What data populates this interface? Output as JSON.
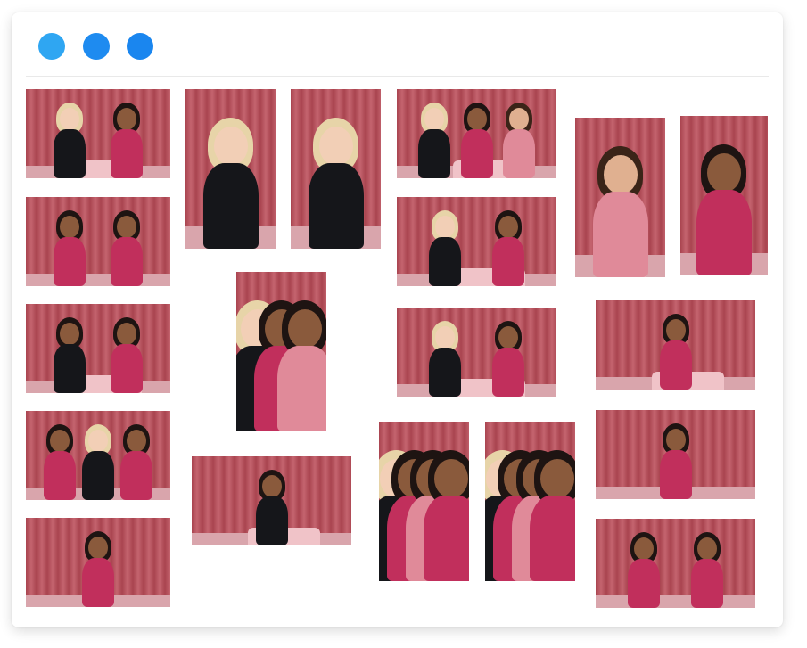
{
  "window": {
    "controls": [
      {
        "name": "window-control-1",
        "color": "#2fa6f2"
      },
      {
        "name": "window-control-2",
        "color": "#1e8bf0"
      },
      {
        "name": "window-control-3",
        "color": "#1a86ef"
      }
    ]
  },
  "palette": {
    "curtain_dark": "#a9444f",
    "curtain_light": "#c4646f",
    "skin_light": "#f2cfb6",
    "skin_tan": "#e0b090",
    "skin_brown": "#8a5a3c",
    "skin_dark": "#6a3f2a",
    "hair_blonde": "#e7d4a8",
    "hair_dark": "#1e1412",
    "hair_brown": "#3a2418",
    "dress_black": "#15161a",
    "dress_magenta": "#c12f5c",
    "dress_pink": "#e08a99",
    "plinth": "#f0c3c8"
  },
  "gallery": {
    "photos": [
      {
        "name": "photo-duo-seated-1",
        "figures": [
          [
            "blonde",
            "black"
          ],
          [
            "dark",
            "magenta"
          ]
        ]
      },
      {
        "name": "photo-duo-standing-1",
        "figures": [
          [
            "dark",
            "magenta"
          ],
          [
            "dark",
            "magenta"
          ]
        ]
      },
      {
        "name": "photo-duo-seated-2",
        "figures": [
          [
            "dark",
            "black"
          ],
          [
            "dark",
            "magenta"
          ]
        ]
      },
      {
        "name": "photo-trio-1",
        "figures": [
          [
            "dark",
            "magenta"
          ],
          [
            "blonde",
            "black"
          ],
          [
            "dark",
            "magenta"
          ]
        ]
      },
      {
        "name": "photo-solo-portrait-1",
        "figures": [
          [
            "dark",
            "magenta"
          ]
        ]
      },
      {
        "name": "photo-solo-blonde-1",
        "figures": [
          [
            "blonde",
            "black"
          ]
        ]
      },
      {
        "name": "photo-solo-blonde-2",
        "figures": [
          [
            "blonde",
            "black"
          ]
        ]
      },
      {
        "name": "photo-trio-2",
        "figures": [
          [
            "blonde",
            "black"
          ],
          [
            "dark",
            "magenta"
          ],
          [
            "brown",
            "pink"
          ]
        ]
      },
      {
        "name": "photo-solo-seated-1",
        "figures": [
          [
            "dark",
            "black"
          ]
        ]
      },
      {
        "name": "photo-group-seated-1",
        "figures": [
          [
            "blonde",
            "black"
          ],
          [
            "dark",
            "magenta"
          ],
          [
            "dark",
            "pink"
          ]
        ]
      },
      {
        "name": "photo-duo-seated-3",
        "figures": [
          [
            "blonde",
            "black"
          ],
          [
            "dark",
            "magenta"
          ]
        ]
      },
      {
        "name": "photo-duo-seated-4",
        "figures": [
          [
            "blonde",
            "black"
          ],
          [
            "dark",
            "magenta"
          ]
        ]
      },
      {
        "name": "photo-group-1",
        "figures": [
          [
            "blonde",
            "black"
          ],
          [
            "dark",
            "magenta"
          ],
          [
            "dark",
            "pink"
          ],
          [
            "dark",
            "magenta"
          ]
        ]
      },
      {
        "name": "photo-group-2",
        "figures": [
          [
            "blonde",
            "black"
          ],
          [
            "dark",
            "magenta"
          ],
          [
            "dark",
            "pink"
          ],
          [
            "dark",
            "magenta"
          ]
        ]
      },
      {
        "name": "photo-solo-portrait-2",
        "figures": [
          [
            "brown",
            "pink"
          ]
        ]
      },
      {
        "name": "photo-solo-seated-2",
        "figures": [
          [
            "dark",
            "magenta"
          ]
        ]
      },
      {
        "name": "photo-solo-seated-3",
        "figures": [
          [
            "dark",
            "magenta"
          ]
        ]
      },
      {
        "name": "photo-solo-standing-1",
        "figures": [
          [
            "dark",
            "magenta"
          ]
        ]
      },
      {
        "name": "photo-duo-standing-2",
        "figures": [
          [
            "dark",
            "magenta"
          ],
          [
            "dark",
            "magenta"
          ]
        ]
      }
    ]
  }
}
